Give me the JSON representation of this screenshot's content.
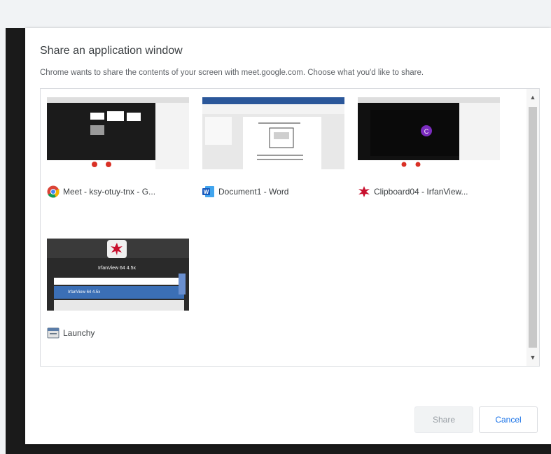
{
  "dialog": {
    "title": "Share an application window",
    "subtitle": "Chrome wants to share the contents of your screen with meet.google.com. Choose what you'd like to share."
  },
  "windows": [
    {
      "label": "Meet - ksy-otuy-tnx - G...",
      "icon": "chrome-icon"
    },
    {
      "label": "Document1 - Word",
      "icon": "word-icon"
    },
    {
      "label": "Clipboard04 - IrfanView...",
      "icon": "irfanview-icon"
    },
    {
      "label": "Launchy",
      "icon": "launchy-icon"
    }
  ],
  "thumb_texts": {
    "launchy_title": "IrfanView 64 4.5x",
    "launchy_item": "IrfanView 64 4.5x"
  },
  "buttons": {
    "share": "Share",
    "cancel": "Cancel"
  },
  "colors": {
    "accent": "#1a73e8",
    "meet_bg": "#1a1a1a",
    "irfan_red": "#c8102e"
  }
}
